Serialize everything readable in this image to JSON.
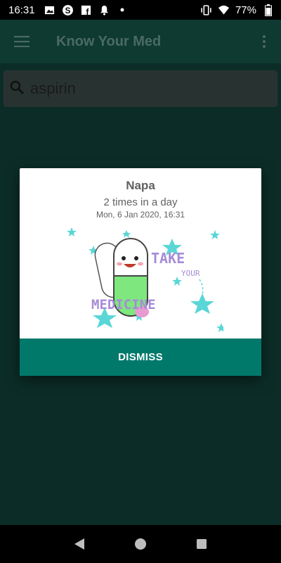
{
  "status": {
    "time": "16:31",
    "battery": "77%",
    "icons": [
      "image-icon",
      "skype-icon",
      "facebook-icon",
      "bell-icon",
      "dot-icon"
    ],
    "right_icons": [
      "vibrate-icon",
      "wifi-icon",
      "battery-icon"
    ]
  },
  "app_bar": {
    "title": "Know Your Med",
    "menu_icon": "hamburger-menu-icon",
    "more_icon": "more-vert-icon"
  },
  "search": {
    "value": "aspirin",
    "icon": "search-icon"
  },
  "dialog": {
    "title": "Napa",
    "dose": "2 times in a day",
    "time": "Mon, 6 Jan 2020, 16:31",
    "illustration_text": [
      "TAKE",
      "YOUR",
      "MEDICINE"
    ],
    "dismiss_label": "DISMISS",
    "accent": "#00796b"
  },
  "nav": {
    "icons": [
      "back-icon",
      "home-icon",
      "recents-icon"
    ]
  },
  "colors": {
    "scrim_bg": "#0b2e27",
    "button": "#00796b",
    "star": "#5ad6d6",
    "pill_green": "#7ee87e",
    "text_purple": "#a78bd8"
  }
}
